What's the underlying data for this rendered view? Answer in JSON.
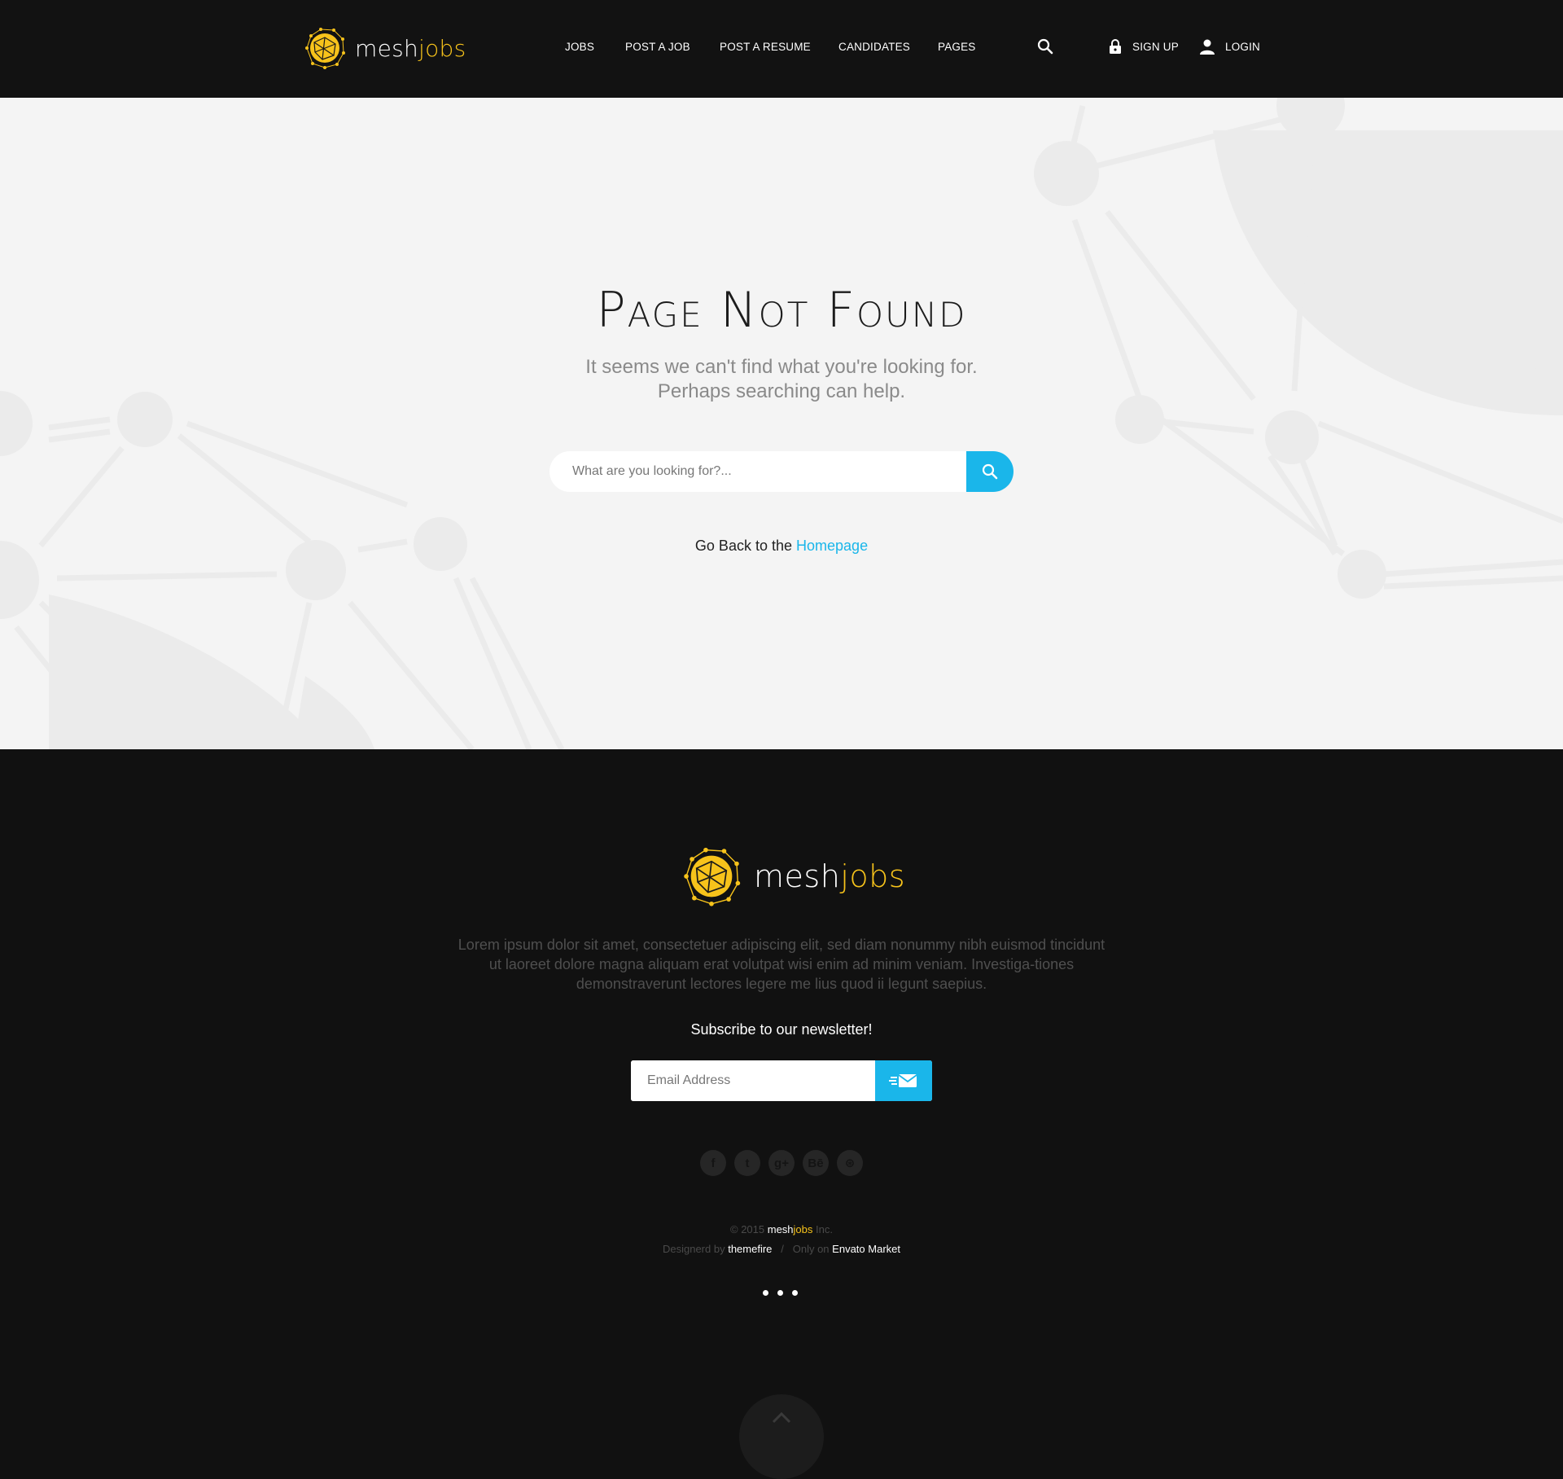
{
  "header": {
    "logo": {
      "part1": "mesh",
      "part2": "jobs"
    },
    "nav": [
      {
        "label": "JOBS"
      },
      {
        "label": "POST A JOB"
      },
      {
        "label": "POST A RESUME"
      },
      {
        "label": "CANDIDATES"
      },
      {
        "label": "PAGES"
      }
    ],
    "signup_label": "SIGN UP",
    "login_label": "LOGIN"
  },
  "hero": {
    "title": "Page Not Found",
    "subtitle_line1": "It seems we can't find what you're looking for.",
    "subtitle_line2": "Perhaps searching can help.",
    "search_placeholder": "What are you looking for?...",
    "goback_text": "Go Back to the",
    "goback_link": "Homepage"
  },
  "footer": {
    "logo": {
      "part1": "mesh",
      "part2": "jobs"
    },
    "description": "Lorem ipsum dolor sit amet, consectetuer adipiscing elit, sed diam nonummy nibh euismod tincidunt ut laoreet dolore magna aliquam erat volutpat wisi enim ad minim veniam. Investiga-tiones demonstraverunt lectores legere me lius quod ii legunt saepius.",
    "newsletter_title": "Subscribe to our newsletter!",
    "email_placeholder": "Email Address",
    "socials": [
      {
        "icon": "facebook-icon",
        "glyph": "f"
      },
      {
        "icon": "twitter-icon",
        "glyph": "t"
      },
      {
        "icon": "google-plus-icon",
        "glyph": "g+"
      },
      {
        "icon": "behance-icon",
        "glyph": "Bē"
      },
      {
        "icon": "dribbble-icon",
        "glyph": "⊛"
      }
    ],
    "copyright_prefix": "© 2015",
    "copyright_brand1": "mesh",
    "copyright_brand2": "jobs",
    "copyright_suffix": "Inc.",
    "designed_by_label": "Designerd by",
    "designer": "themefire",
    "separator": "/",
    "only_on_label": "Only on",
    "market": "Envato Market"
  },
  "colors": {
    "accent": "#1ab6ea",
    "brand_yellow": "#f7c31b",
    "header_bg": "#121212",
    "hero_bg": "#f4f4f4"
  }
}
